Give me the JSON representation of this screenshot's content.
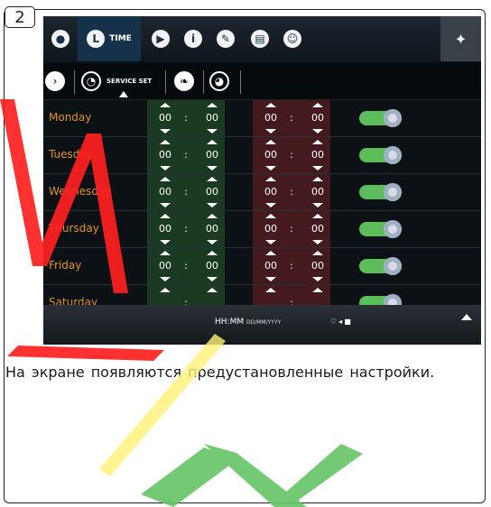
{
  "step_number": "2",
  "topbar": {
    "items": [
      {
        "icon": "water-drop-icon"
      },
      {
        "icon": "clock-icon",
        "label": "TIME"
      },
      {
        "icon": "flag-icon"
      },
      {
        "icon": "info-icon"
      },
      {
        "icon": "pencil-icon"
      },
      {
        "icon": "calendar-icon"
      },
      {
        "icon": "user-icon"
      },
      {
        "icon": "wrench-icon"
      }
    ]
  },
  "subbar": {
    "items": [
      {
        "icon": "chevron-right-icon"
      },
      {
        "icon": "timer-icon",
        "label": "SERVICE SET"
      },
      {
        "icon": "leaf-icon"
      },
      {
        "icon": "timer-drop-icon"
      }
    ]
  },
  "schedule": {
    "rows": [
      {
        "day": "Monday",
        "start_h": "00",
        "start_m": "00",
        "end_h": "00",
        "end_m": "00",
        "enabled": true
      },
      {
        "day": "Tuesday",
        "start_h": "00",
        "start_m": "00",
        "end_h": "00",
        "end_m": "00",
        "enabled": true
      },
      {
        "day": "Wednesday",
        "start_h": "00",
        "start_m": "00",
        "end_h": "00",
        "end_m": "00",
        "enabled": true
      },
      {
        "day": "Thursday",
        "start_h": "00",
        "start_m": "00",
        "end_h": "00",
        "end_m": "00",
        "enabled": true
      },
      {
        "day": "Friday",
        "start_h": "00",
        "start_m": "00",
        "end_h": "00",
        "end_m": "00",
        "enabled": true
      },
      {
        "day": "Saturday",
        "start_h": "",
        "start_m": "",
        "end_h": "",
        "end_m": "",
        "enabled": true
      }
    ]
  },
  "bottombar": {
    "time_format": "HH:MM",
    "date_format": "DD/MM/YYYY"
  },
  "caption": "На экране появляются предустановленные настройки.",
  "colors": {
    "day_label": "#e0932a",
    "start_box": "#1b3a22",
    "end_box": "#451a1e",
    "toggle_on": "#5cbd5a",
    "topbar_active": "#16324a",
    "watermark_red": "#ff2020",
    "watermark_yellow": "#fff176",
    "watermark_green": "#66c466"
  }
}
